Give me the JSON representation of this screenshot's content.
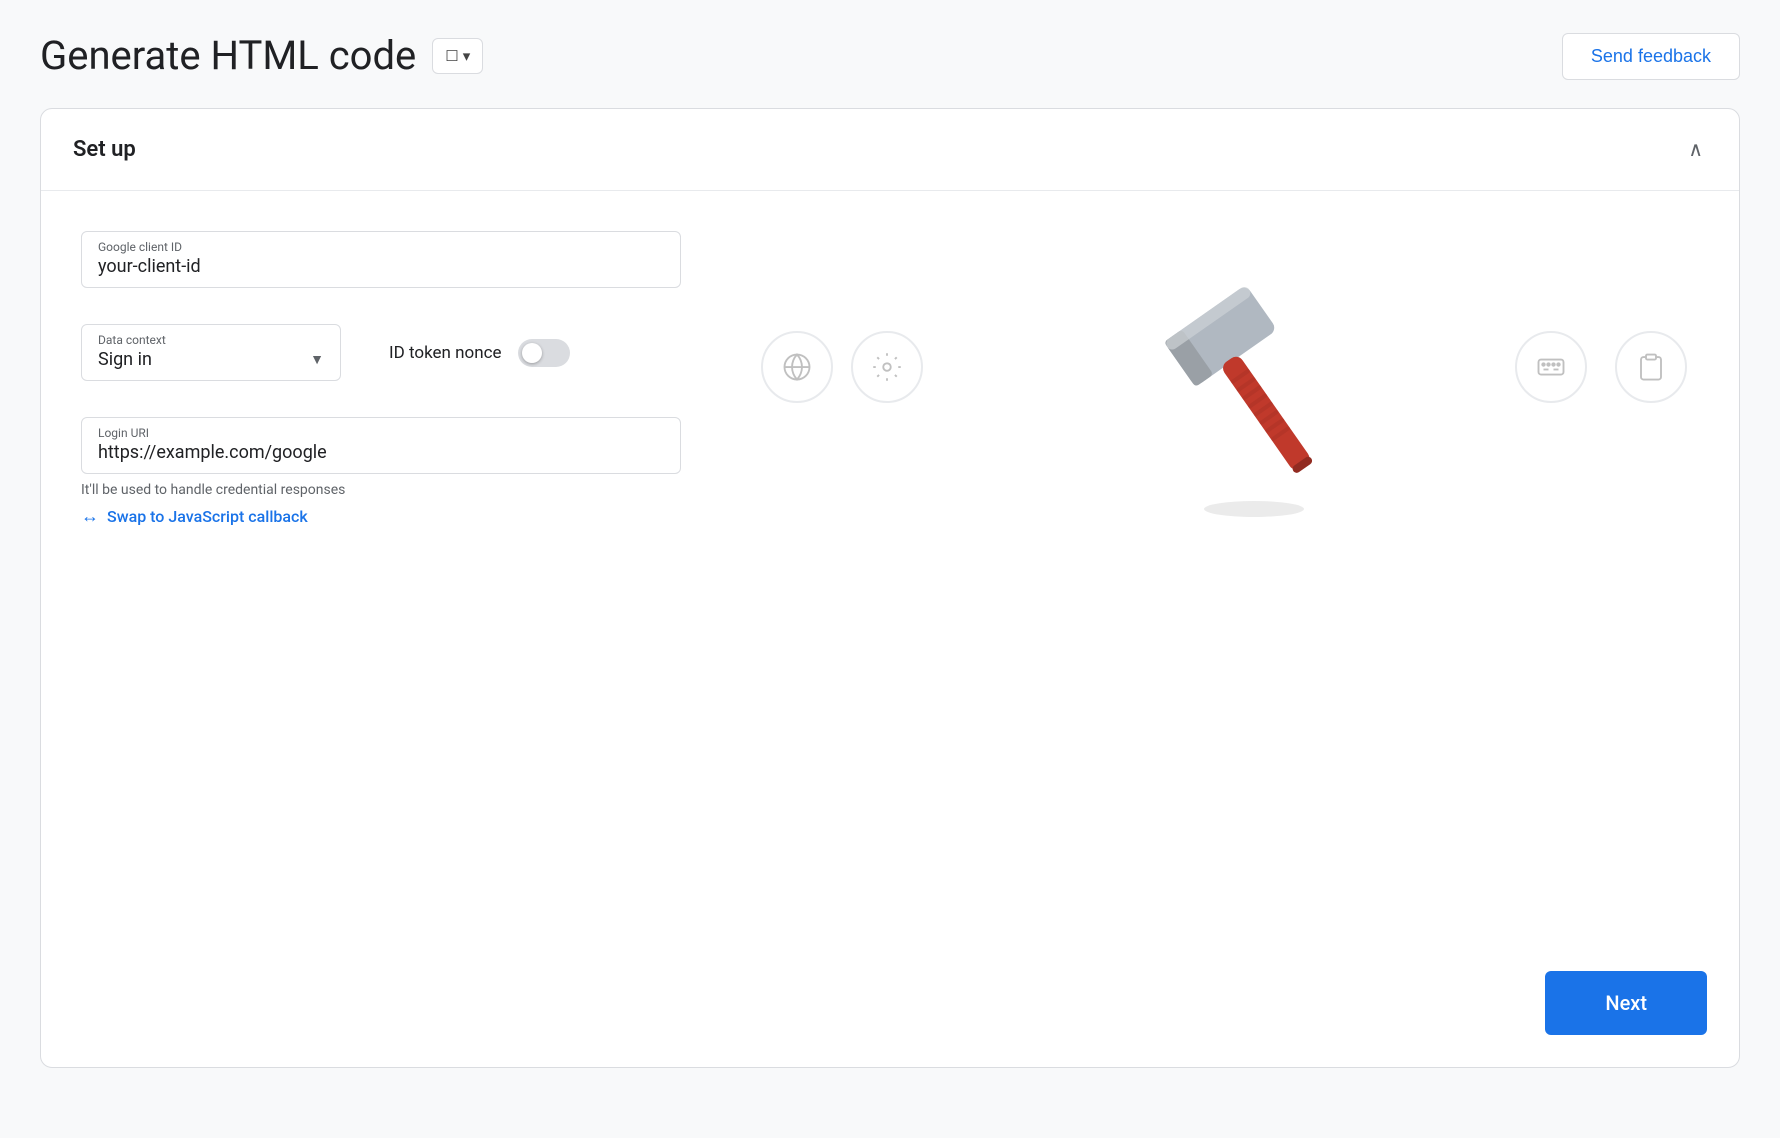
{
  "page": {
    "title": "Generate HTML code",
    "bookmark_label": "🔖",
    "chevron_down": "▾"
  },
  "header": {
    "send_feedback_label": "Send feedback"
  },
  "card": {
    "section_title": "Set up",
    "collapse_icon": "∧"
  },
  "form": {
    "client_id_label": "Google client ID",
    "client_id_value": "your-client-id",
    "data_context_label": "Data context",
    "data_context_value": "Sign in",
    "id_token_nonce_label": "ID token nonce",
    "login_uri_label": "Login URI",
    "login_uri_value": "https://example.com/google",
    "login_uri_hint": "It'll be used to handle credential responses",
    "swap_link_label": "Swap to JavaScript callback",
    "swap_icon": "↔"
  },
  "actions": {
    "next_label": "Next"
  },
  "icons": {
    "globe": "🌐",
    "gear": "⚙",
    "keyboard": "⌨",
    "clipboard": "📋"
  }
}
